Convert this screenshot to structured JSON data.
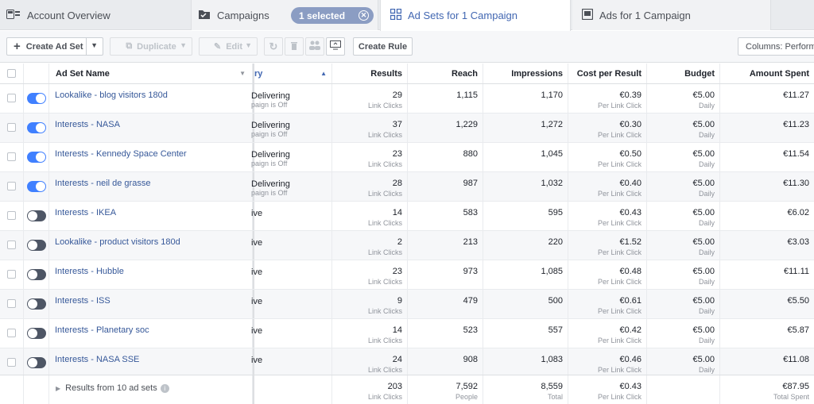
{
  "tabs": {
    "account": "Account Overview",
    "campaigns": "Campaigns",
    "selected": "1 selected",
    "adsets": "Ad Sets for 1 Campaign",
    "ads": "Ads for 1 Campaign"
  },
  "toolbar": {
    "create": "Create Ad Set",
    "duplicate": "Duplicate",
    "edit": "Edit",
    "create_rule": "Create Rule",
    "columns": "Columns: Perform"
  },
  "header": {
    "name": "Ad Set Name",
    "delivery": "ry",
    "results": "Results",
    "reach": "Reach",
    "impressions": "Impressions",
    "cpr": "Cost per Result",
    "budget": "Budget",
    "spent": "Amount Spent"
  },
  "rows": [
    {
      "name": "Lookalike - blog visitors 180d",
      "on": true,
      "delivery": "Delivering",
      "delivery_sub": "paign is Off",
      "results": "29",
      "results_sub": "Link Clicks",
      "reach": "1,115",
      "impressions": "1,170",
      "cpr": "€0.39",
      "cpr_sub": "Per Link Click",
      "budget": "€5.00",
      "budget_sub": "Daily",
      "spent": "€11.27"
    },
    {
      "name": "Interests - NASA",
      "on": true,
      "delivery": "Delivering",
      "delivery_sub": "paign is Off",
      "results": "37",
      "results_sub": "Link Clicks",
      "reach": "1,229",
      "impressions": "1,272",
      "cpr": "€0.30",
      "cpr_sub": "Per Link Click",
      "budget": "€5.00",
      "budget_sub": "Daily",
      "spent": "€11.23"
    },
    {
      "name": "Interests - Kennedy Space Center",
      "on": true,
      "delivery": "Delivering",
      "delivery_sub": "paign is Off",
      "results": "23",
      "results_sub": "Link Clicks",
      "reach": "880",
      "impressions": "1,045",
      "cpr": "€0.50",
      "cpr_sub": "Per Link Click",
      "budget": "€5.00",
      "budget_sub": "Daily",
      "spent": "€11.54"
    },
    {
      "name": "Interests - neil de grasse",
      "on": true,
      "delivery": "Delivering",
      "delivery_sub": "paign is Off",
      "results": "28",
      "results_sub": "Link Clicks",
      "reach": "987",
      "impressions": "1,032",
      "cpr": "€0.40",
      "cpr_sub": "Per Link Click",
      "budget": "€5.00",
      "budget_sub": "Daily",
      "spent": "€11.30"
    },
    {
      "name": "Interests - IKEA",
      "on": false,
      "delivery": "ive",
      "delivery_sub": "",
      "results": "14",
      "results_sub": "Link Clicks",
      "reach": "583",
      "impressions": "595",
      "cpr": "€0.43",
      "cpr_sub": "Per Link Click",
      "budget": "€5.00",
      "budget_sub": "Daily",
      "spent": "€6.02"
    },
    {
      "name": "Lookalike - product visitors 180d",
      "on": false,
      "delivery": "ive",
      "delivery_sub": "",
      "results": "2",
      "results_sub": "Link Clicks",
      "reach": "213",
      "impressions": "220",
      "cpr": "€1.52",
      "cpr_sub": "Per Link Click",
      "budget": "€5.00",
      "budget_sub": "Daily",
      "spent": "€3.03"
    },
    {
      "name": "Interests - Hubble",
      "on": false,
      "delivery": "ive",
      "delivery_sub": "",
      "results": "23",
      "results_sub": "Link Clicks",
      "reach": "973",
      "impressions": "1,085",
      "cpr": "€0.48",
      "cpr_sub": "Per Link Click",
      "budget": "€5.00",
      "budget_sub": "Daily",
      "spent": "€11.11"
    },
    {
      "name": "Interests - ISS",
      "on": false,
      "delivery": "ive",
      "delivery_sub": "",
      "results": "9",
      "results_sub": "Link Clicks",
      "reach": "479",
      "impressions": "500",
      "cpr": "€0.61",
      "cpr_sub": "Per Link Click",
      "budget": "€5.00",
      "budget_sub": "Daily",
      "spent": "€5.50"
    },
    {
      "name": "Interests - Planetary soc",
      "on": false,
      "delivery": "ive",
      "delivery_sub": "",
      "results": "14",
      "results_sub": "Link Clicks",
      "reach": "523",
      "impressions": "557",
      "cpr": "€0.42",
      "cpr_sub": "Per Link Click",
      "budget": "€5.00",
      "budget_sub": "Daily",
      "spent": "€5.87"
    },
    {
      "name": "Interests - NASA SSE",
      "on": false,
      "delivery": "ive",
      "delivery_sub": "",
      "results": "24",
      "results_sub": "Link Clicks",
      "reach": "908",
      "impressions": "1,083",
      "cpr": "€0.46",
      "cpr_sub": "Per Link Click",
      "budget": "€5.00",
      "budget_sub": "Daily",
      "spent": "€11.08"
    }
  ],
  "totals": {
    "label": "Results from 10 ad sets",
    "results": "203",
    "results_sub": "Link Clicks",
    "reach": "7,592",
    "reach_sub": "People",
    "impressions": "8,559",
    "impressions_sub": "Total",
    "cpr": "€0.43",
    "cpr_sub": "Per Link Click",
    "spent": "€87.95",
    "spent_sub": "Total Spent"
  },
  "colors": {
    "accent": "#4267b2",
    "toggle_on": "#4080ff",
    "toggle_off": "#4e5665",
    "link": "#365899"
  }
}
